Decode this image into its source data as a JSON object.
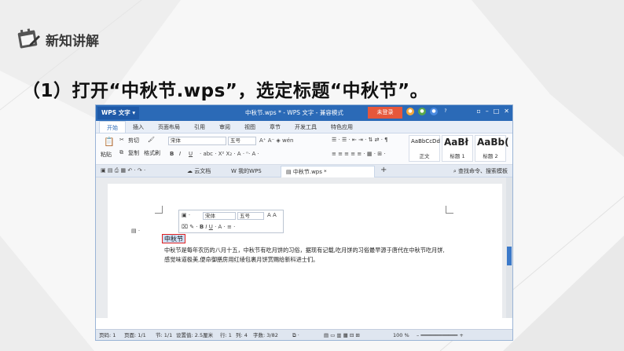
{
  "slide": {
    "section_title": "新知讲解",
    "instruction": "（1）打开“中秋节.wps”，选定标题“中秋节”。"
  },
  "window": {
    "app_button": "WPS 文字",
    "doc_title": "中秋节.wps * - WPS 文字 - 兼容模式",
    "login_button": "未登录",
    "menu": [
      "开始",
      "插入",
      "页面布局",
      "引用",
      "审阅",
      "视图",
      "章节",
      "开发工具",
      "特色应用"
    ],
    "active_menu": "开始",
    "ribbon": {
      "paste": "粘贴",
      "cut": "剪切",
      "copy": "复制",
      "format_painter": "格式刷",
      "font_name": "宋体",
      "font_size": "五号",
      "styles": [
        {
          "preview": "AaBbCcDd",
          "name": "正文"
        },
        {
          "preview": "AaBł",
          "name": "标题 1"
        },
        {
          "preview": "AaBb(",
          "name": "标题 2"
        }
      ]
    },
    "tabs": [
      "云文档",
      "我的WPS",
      "中秋节.wps *"
    ],
    "search_commands": "查找命令、搜索模板",
    "mini_toolbar": {
      "font_name": "宋体",
      "font_size": "五号"
    },
    "document": {
      "heading": "中秋节",
      "body": "中秋节是每年农历的八月十五，中秋节有吃月饼的习俗，据现有记载,吃月饼的习俗最早源于唐代在中秋节吃月饼,感觉味道极美,便命御膳房用红绫包裹月饼赏赐给新科进士们。"
    },
    "status": {
      "page_no": "页码: 1",
      "pages": "页面: 1/1",
      "section": "节: 1/1",
      "setting": "设置值: 2.5厘米",
      "row": "行: 1",
      "col": "列: 4",
      "words": "字数: 3/82",
      "zoom": "100 %"
    }
  },
  "colors": {
    "title_bar": "#2b6ab7",
    "login": "#e6573b",
    "selection_border": "#e02020"
  }
}
